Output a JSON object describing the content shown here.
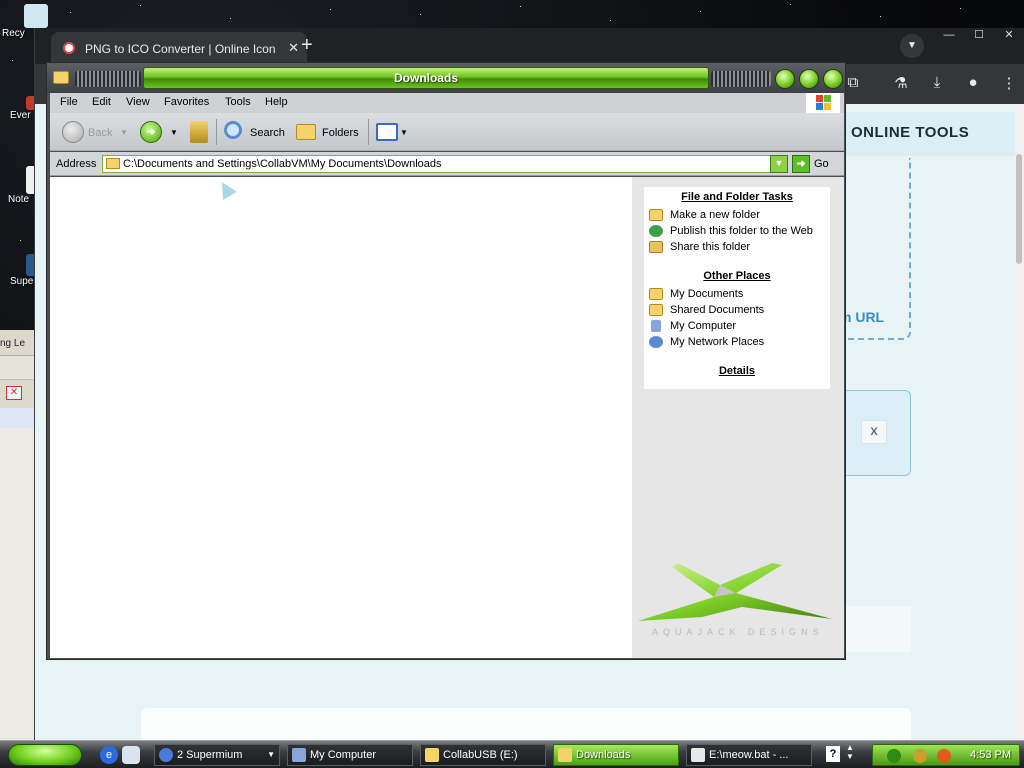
{
  "desktop": {
    "icons": [
      {
        "label": "Recy"
      },
      {
        "label": "Ever"
      },
      {
        "label": "Note"
      },
      {
        "label": "Supe"
      }
    ]
  },
  "bg_app": {
    "menu_text": "ng   Le"
  },
  "browser": {
    "tab_title": "PNG to ICO Converter | Online Icon",
    "tab_close": "✕",
    "new_tab": "+",
    "window_buttons": [
      "—",
      "☐",
      "✕"
    ],
    "page": {
      "online_tools": "ONLINE TOOLS",
      "from_url": "m URL",
      "close_x": "X"
    }
  },
  "explorer": {
    "title": "Downloads",
    "menu": [
      "File",
      "Edit",
      "View",
      "Favorites",
      "Tools",
      "Help"
    ],
    "toolbar": {
      "back": "Back",
      "search": "Search",
      "folders": "Folders"
    },
    "address": {
      "label": "Address",
      "value": "C:\\Documents and Settings\\CollabVM\\My Documents\\Downloads",
      "go": "Go"
    },
    "side": {
      "file_folder_tasks": {
        "heading": "File and Folder Tasks",
        "items": [
          {
            "label": "Make a new folder",
            "icon": "new-folder-icon",
            "color": "#f3d36a"
          },
          {
            "label": "Publish this folder to the Web",
            "icon": "web-publish-icon",
            "color": "#3aa14a"
          },
          {
            "label": "Share this folder",
            "icon": "share-folder-icon",
            "color": "#e8c25a"
          }
        ]
      },
      "other_places": {
        "heading": "Other Places",
        "items": [
          {
            "label": "My Documents",
            "icon": "my-documents-icon",
            "color": "#f3d36a"
          },
          {
            "label": "Shared Documents",
            "icon": "shared-documents-icon",
            "color": "#f3d36a"
          },
          {
            "label": "My Computer",
            "icon": "my-computer-icon",
            "color": "#8aa6d8"
          },
          {
            "label": "My Network Places",
            "icon": "network-places-icon",
            "color": "#5a8ad0"
          }
        ]
      },
      "details_heading": "Details",
      "logo_text": "AQUAJACK DESIGNS"
    }
  },
  "taskbar": {
    "buttons": [
      {
        "label": "2 Supermium",
        "icon": "browser-icon",
        "color": "#4a7ad8",
        "active": false
      },
      {
        "label": "My Computer",
        "icon": "computer-icon",
        "color": "#8aa6d8",
        "active": false
      },
      {
        "label": "CollabUSB (E:)",
        "icon": "drive-icon",
        "color": "#f3d36a",
        "active": false
      },
      {
        "label": "Downloads",
        "icon": "folder-icon",
        "color": "#f3d36a",
        "active": true
      },
      {
        "label": "E:\\meow.bat - ...",
        "icon": "notepad-icon",
        "color": "#e8e8e8",
        "active": false
      }
    ],
    "clock": "4:53 PM",
    "help": "?"
  },
  "colors": {
    "accent_green": "#6fc21e",
    "desktop_bg": "#08090b"
  }
}
